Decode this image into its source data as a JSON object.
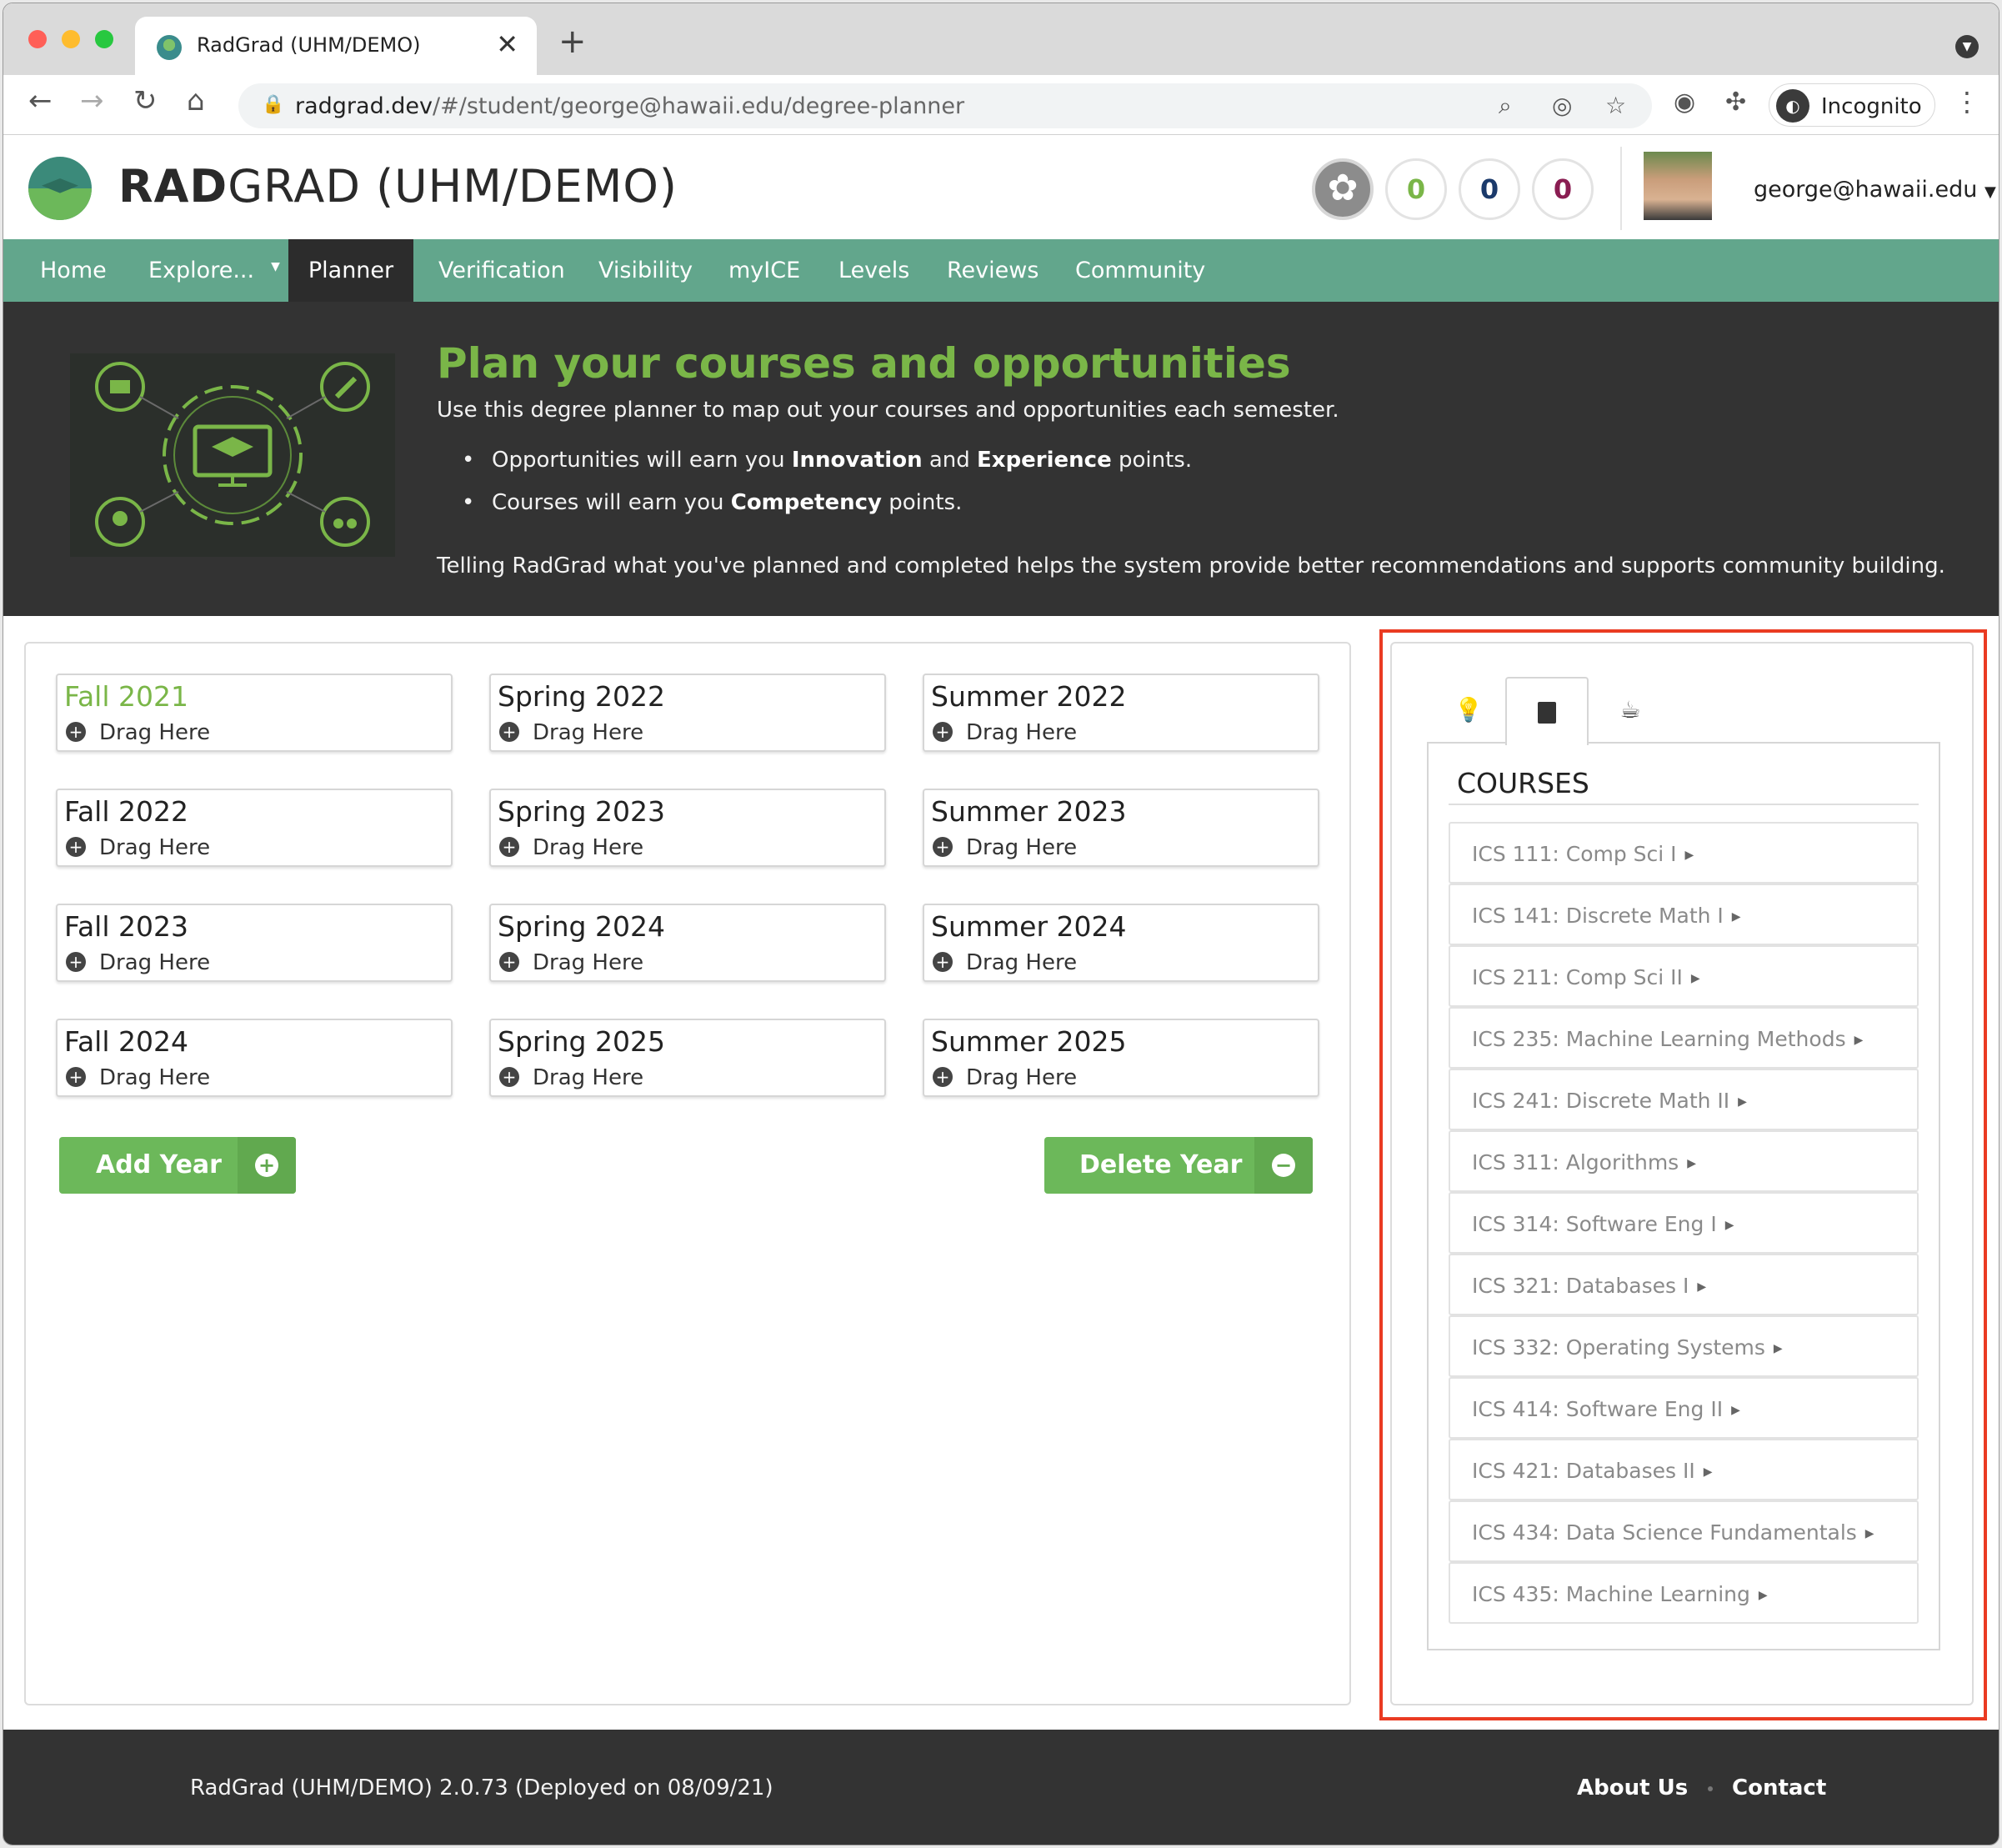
{
  "browser": {
    "tab_title": "RadGrad (UHM/DEMO)",
    "tab_close": "✕",
    "new_tab": "+",
    "url_host": "radgrad.dev",
    "url_path": "/#/student/george@hawaii.edu/degree-planner",
    "profile_label": "Incognito"
  },
  "app": {
    "brand_bold": "RAD",
    "brand_rest": "GRAD (UHM/DEMO)",
    "ice": {
      "innovation": "0",
      "competency": "0",
      "experience": "0"
    },
    "user": "george@hawaii.edu",
    "colors": {
      "green": "#7ab648",
      "nav": "#62a68c",
      "dark": "#333333",
      "highlight": "#ea3b22"
    }
  },
  "nav": {
    "items": [
      "Home",
      "Explore...",
      "Planner",
      "Verification",
      "Visibility",
      "myICE",
      "Levels",
      "Reviews",
      "Community"
    ],
    "active": "Planner"
  },
  "hero": {
    "title": "Plan your courses and opportunities",
    "subtitle": "Use this degree planner to map out your courses and opportunities each semester.",
    "bullet1": {
      "pre": "Opportunities will earn you ",
      "b1": "Innovation",
      "mid": " and ",
      "b2": "Experience",
      "post": " points."
    },
    "bullet2": {
      "pre": "Courses will earn you ",
      "b1": "Competency",
      "post": " points."
    },
    "footer": "Telling RadGrad what you've planned and completed helps the system provide better recommendations and supports community building."
  },
  "planner": {
    "drop_label": "Drag Here",
    "semesters": [
      [
        "Fall 2021",
        "Spring 2022",
        "Summer 2022"
      ],
      [
        "Fall 2022",
        "Spring 2023",
        "Summer 2023"
      ],
      [
        "Fall 2023",
        "Spring 2024",
        "Summer 2024"
      ],
      [
        "Fall 2024",
        "Spring 2025",
        "Summer 2025"
      ]
    ],
    "current_semester": "Fall 2021",
    "add_year": "Add Year",
    "delete_year": "Delete Year"
  },
  "sidebar": {
    "tabs": [
      "lightbulb-icon",
      "book-icon",
      "coffee-icon"
    ],
    "active_tab": "book-icon",
    "heading": "COURSES",
    "courses": [
      "ICS 111: Comp Sci I",
      "ICS 141: Discrete Math I",
      "ICS 211: Comp Sci II",
      "ICS 235: Machine Learning Methods",
      "ICS 241: Discrete Math II",
      "ICS 311: Algorithms",
      "ICS 314: Software Eng I",
      "ICS 321: Databases I",
      "ICS 332: Operating Systems",
      "ICS 414: Software Eng II",
      "ICS 421: Databases II",
      "ICS 434: Data Science Fundamentals",
      "ICS 435: Machine Learning"
    ]
  },
  "footer": {
    "version": "RadGrad (UHM/DEMO) 2.0.73 (Deployed on 08/09/21)",
    "about": "About Us",
    "contact": "Contact"
  }
}
